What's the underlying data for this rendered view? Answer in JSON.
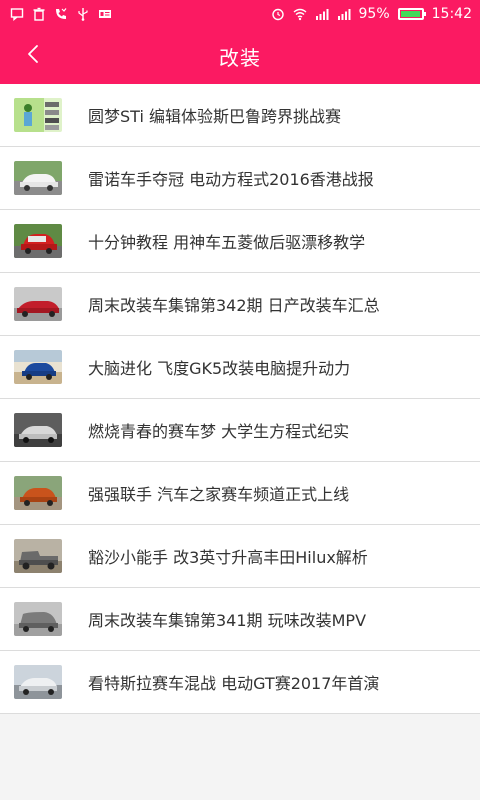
{
  "status_bar": {
    "battery_percent": "95%",
    "time": "15:42",
    "battery_level": 0.95,
    "icons_left": [
      "message-icon",
      "trash-icon",
      "missed-call-icon",
      "usb-icon",
      "news-icon"
    ],
    "icons_right": [
      "alarm-icon",
      "wifi-icon",
      "signal-icon",
      "signal-icon",
      "battery-icon"
    ]
  },
  "header": {
    "title": "改装",
    "back_icon": "chevron-left-icon",
    "background_color": "#fb1a62"
  },
  "list": {
    "items": [
      {
        "title": "圆梦STi 编辑体验斯巴鲁跨界挑战赛",
        "thumb": "poster-thumbnail"
      },
      {
        "title": "雷诺车手夺冠 电动方程式2016香港战报",
        "thumb": "white-car-thumbnail"
      },
      {
        "title": "十分钟教程 用神车五菱做后驱漂移教学",
        "thumb": "red-car-thumbnail"
      },
      {
        "title": "周末改装车集锦第342期 日产改装车汇总",
        "thumb": "red-sedan-thumbnail"
      },
      {
        "title": "大脑进化 飞度GK5改装电脑提升动力",
        "thumb": "blue-hatch-thumbnail"
      },
      {
        "title": "燃烧青春的赛车梦 大学生方程式纪实",
        "thumb": "silver-car-thumbnail"
      },
      {
        "title": "强强联手 汽车之家赛车频道正式上线",
        "thumb": "orange-car-thumbnail"
      },
      {
        "title": "豁沙小能手 改3英寸升高丰田Hilux解析",
        "thumb": "pickup-thumbnail"
      },
      {
        "title": "周末改装车集锦第341期 玩味改装MPV",
        "thumb": "mpv-thumbnail"
      },
      {
        "title": "看特斯拉赛车混战 电动GT赛2017年首演",
        "thumb": "tesla-thumbnail"
      }
    ]
  }
}
